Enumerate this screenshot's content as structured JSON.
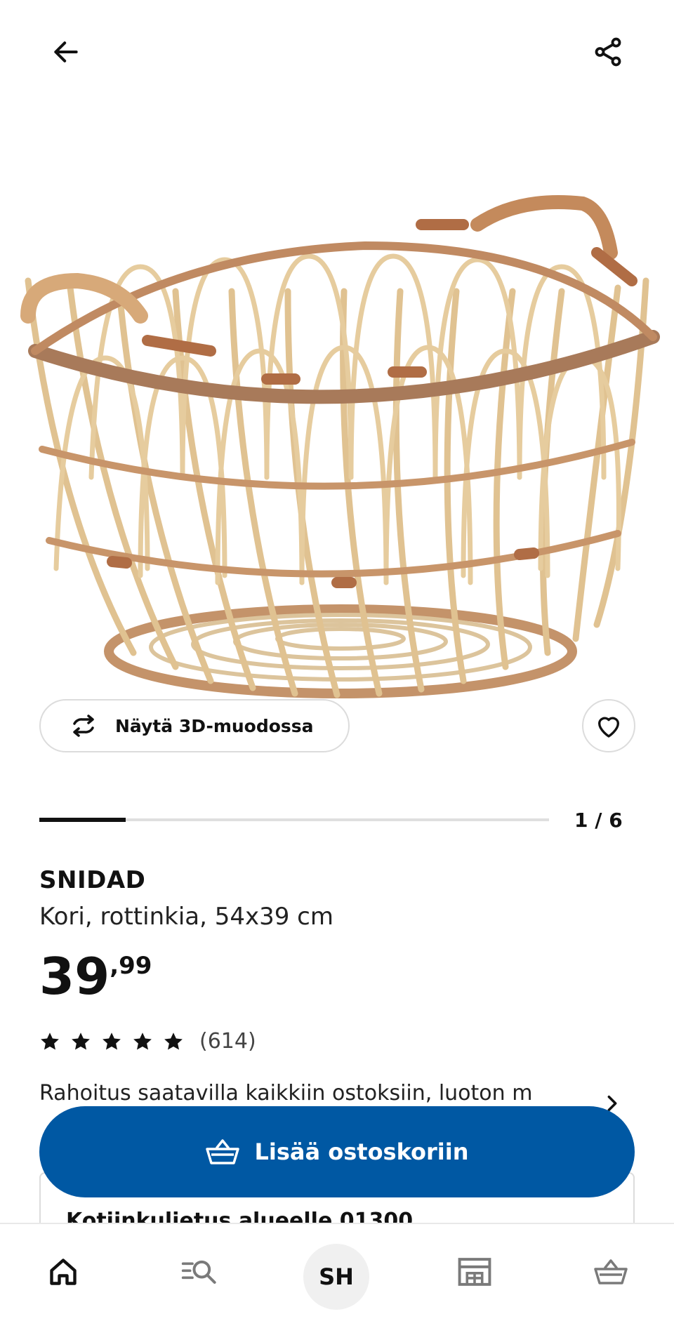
{
  "topbar": {
    "back_icon": "arrow-left-icon",
    "share_icon": "share-icon"
  },
  "gallery": {
    "image_name": "rattan-basket",
    "view_3d_label": "Näytä 3D-muodossa",
    "view_3d_icon": "rotate-3d-icon",
    "favourite_icon": "heart-icon",
    "counter": "1 / 6",
    "progress": 0.17
  },
  "product": {
    "name": "SNIDAD",
    "description": "Kori, rottinkia, 54x39 cm",
    "price_integer": "39",
    "price_decimal": ",99",
    "rating_stars": 5,
    "review_count": "(614)",
    "financing_text": "Rahoitus saatavilla kaikkiin ostoksiin, luoton m"
  },
  "cart_button": {
    "label": "Lisää ostoskoriin",
    "icon": "basket-icon",
    "color": "#0058a3"
  },
  "delivery": {
    "title": "Kotiinkuljetus alueelle 01300"
  },
  "bottom_nav": {
    "items": [
      {
        "icon": "home-icon"
      },
      {
        "icon": "search-list-icon"
      },
      {
        "label": "SH"
      },
      {
        "icon": "store-icon"
      },
      {
        "icon": "cart-icon"
      }
    ]
  },
  "colors": {
    "primary_blue": "#0058a3",
    "text": "#111111",
    "border": "#dcdcdc",
    "basket_light": "#d9b98b",
    "basket_dark": "#b77b52"
  }
}
